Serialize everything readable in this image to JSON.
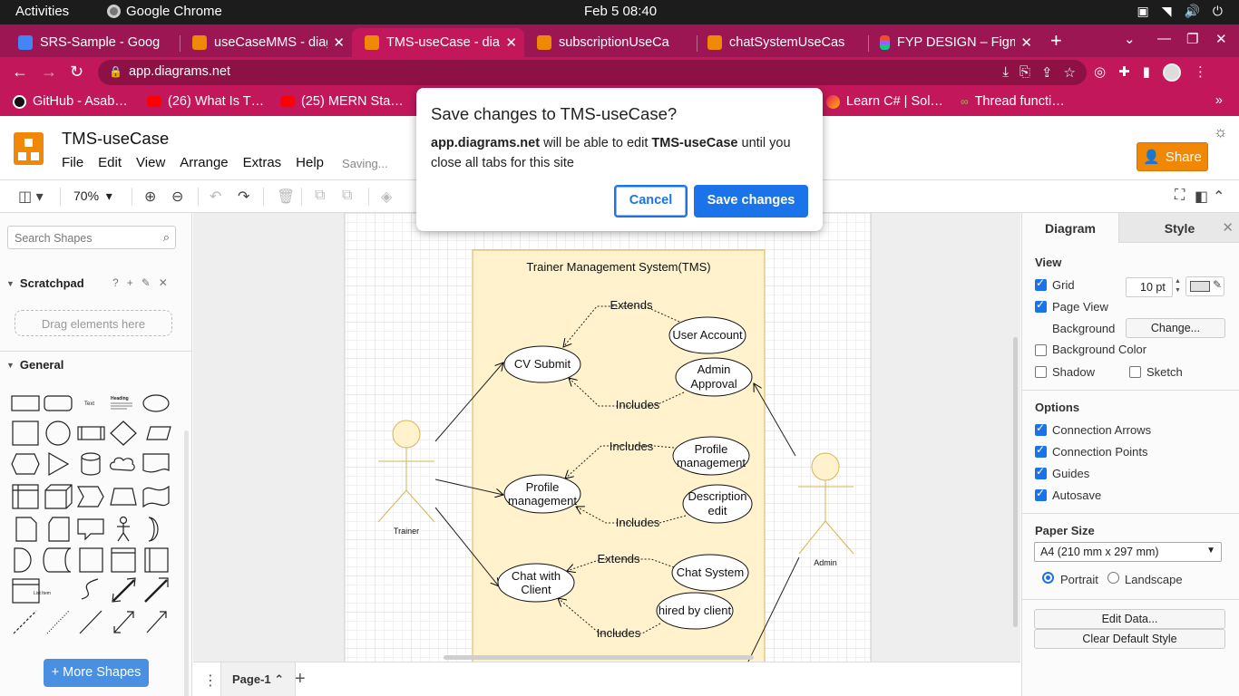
{
  "system_bar": {
    "activities": "Activities",
    "app_name": "Google Chrome",
    "clock": "Feb 5  08:40"
  },
  "browser": {
    "tabs": [
      {
        "title": "SRS-Sample - Goog",
        "favicon": "docs"
      },
      {
        "title": "useCaseMMS - diag",
        "favicon": "drawio"
      },
      {
        "title": "TMS-useCase - diag",
        "favicon": "drawio",
        "active": true
      },
      {
        "title": "subscriptionUseCa",
        "favicon": "drawio"
      },
      {
        "title": "chatSystemUseCas",
        "favicon": "drawio"
      },
      {
        "title": "FYP DESIGN – Figm",
        "favicon": "figma"
      }
    ],
    "url": "app.diagrams.net",
    "bookmarks": [
      {
        "label": "GitHub - Asab…",
        "icon": "github-icon"
      },
      {
        "label": "(26) What Is T…",
        "icon": "youtube-icon"
      },
      {
        "label": "(25) MERN Sta…",
        "icon": "youtube-icon"
      },
      {
        "label": "Learn C# | Sol…",
        "icon": "sololearn-icon"
      },
      {
        "label": "Thread functi…",
        "icon": "thread-icon"
      }
    ],
    "theme_color": "#c2185b"
  },
  "app": {
    "doc_title": "TMS-useCase",
    "menu": [
      "File",
      "Edit",
      "View",
      "Arrange",
      "Extras",
      "Help"
    ],
    "status": "Saving...",
    "share_label": "Share",
    "zoom": "70%"
  },
  "left_panel": {
    "search_placeholder": "Search Shapes",
    "scratchpad_title": "Scratchpad",
    "scratchpad_tools": [
      "?",
      "+",
      "✎",
      "✕"
    ],
    "drop_hint": "Drag elements here",
    "general_title": "General",
    "more_shapes": "More Shapes",
    "shape_text_labels": [
      "Text",
      "Heading",
      "List Item"
    ]
  },
  "diagram": {
    "system_title": "Trainer Management System(TMS)",
    "actors": [
      {
        "name": "Trainer"
      },
      {
        "name": "Admin"
      }
    ],
    "use_cases": [
      {
        "id": "cv",
        "label": [
          "CV Submit"
        ]
      },
      {
        "id": "ua",
        "label": [
          "User Account"
        ]
      },
      {
        "id": "aa",
        "label": [
          "Admin",
          "Approval"
        ]
      },
      {
        "id": "pm1",
        "label": [
          "Profile",
          "management"
        ]
      },
      {
        "id": "pm2",
        "label": [
          "Profile",
          "management"
        ]
      },
      {
        "id": "de",
        "label": [
          "Description",
          "edit"
        ]
      },
      {
        "id": "cc",
        "label": [
          "Chat with",
          "Client"
        ]
      },
      {
        "id": "cs",
        "label": [
          "Chat System"
        ]
      },
      {
        "id": "hc",
        "label": [
          "hired by client"
        ]
      }
    ],
    "relations": [
      {
        "from": "ua",
        "to": "cv",
        "label": "Extends"
      },
      {
        "from": "aa",
        "to": "cv",
        "label": "Includes"
      },
      {
        "from": "pm2",
        "to": "pm1",
        "label": "Includes"
      },
      {
        "from": "de",
        "to": "pm1",
        "label": "Includes"
      },
      {
        "from": "cs",
        "to": "cc",
        "label": "Extends"
      },
      {
        "from": "hc",
        "to": "cc",
        "label": "Includes"
      }
    ],
    "colors": {
      "boundary_fill": "#fff2cc",
      "boundary_stroke": "#d6b656",
      "actor_fill": "#fff2cc",
      "actor_stroke": "#d6b656"
    }
  },
  "page_tab": "Page-1",
  "right_panel": {
    "tabs": [
      "Diagram",
      "Style"
    ],
    "view_title": "View",
    "grid_label": "Grid",
    "grid_size": "10 pt",
    "page_view_label": "Page View",
    "background_label": "Background",
    "change_button": "Change...",
    "background_color_label": "Background Color",
    "shadow_label": "Shadow",
    "sketch_label": "Sketch",
    "options_title": "Options",
    "options": [
      {
        "label": "Connection Arrows",
        "checked": true
      },
      {
        "label": "Connection Points",
        "checked": true
      },
      {
        "label": "Guides",
        "checked": true
      },
      {
        "label": "Autosave",
        "checked": true
      }
    ],
    "paper_size_title": "Paper Size",
    "paper_size": "A4 (210 mm x 297 mm)",
    "portrait_label": "Portrait",
    "landscape_label": "Landscape",
    "edit_data_button": "Edit Data...",
    "clear_style_button": "Clear Default Style"
  },
  "dialog": {
    "title": "Save changes to TMS-useCase?",
    "site": "app.diagrams.net",
    "text_1": " will be able to edit ",
    "file": "TMS-useCase",
    "text_2": " until you close all tabs for this site",
    "cancel": "Cancel",
    "save": "Save changes",
    "accent": "#1a73e8"
  }
}
